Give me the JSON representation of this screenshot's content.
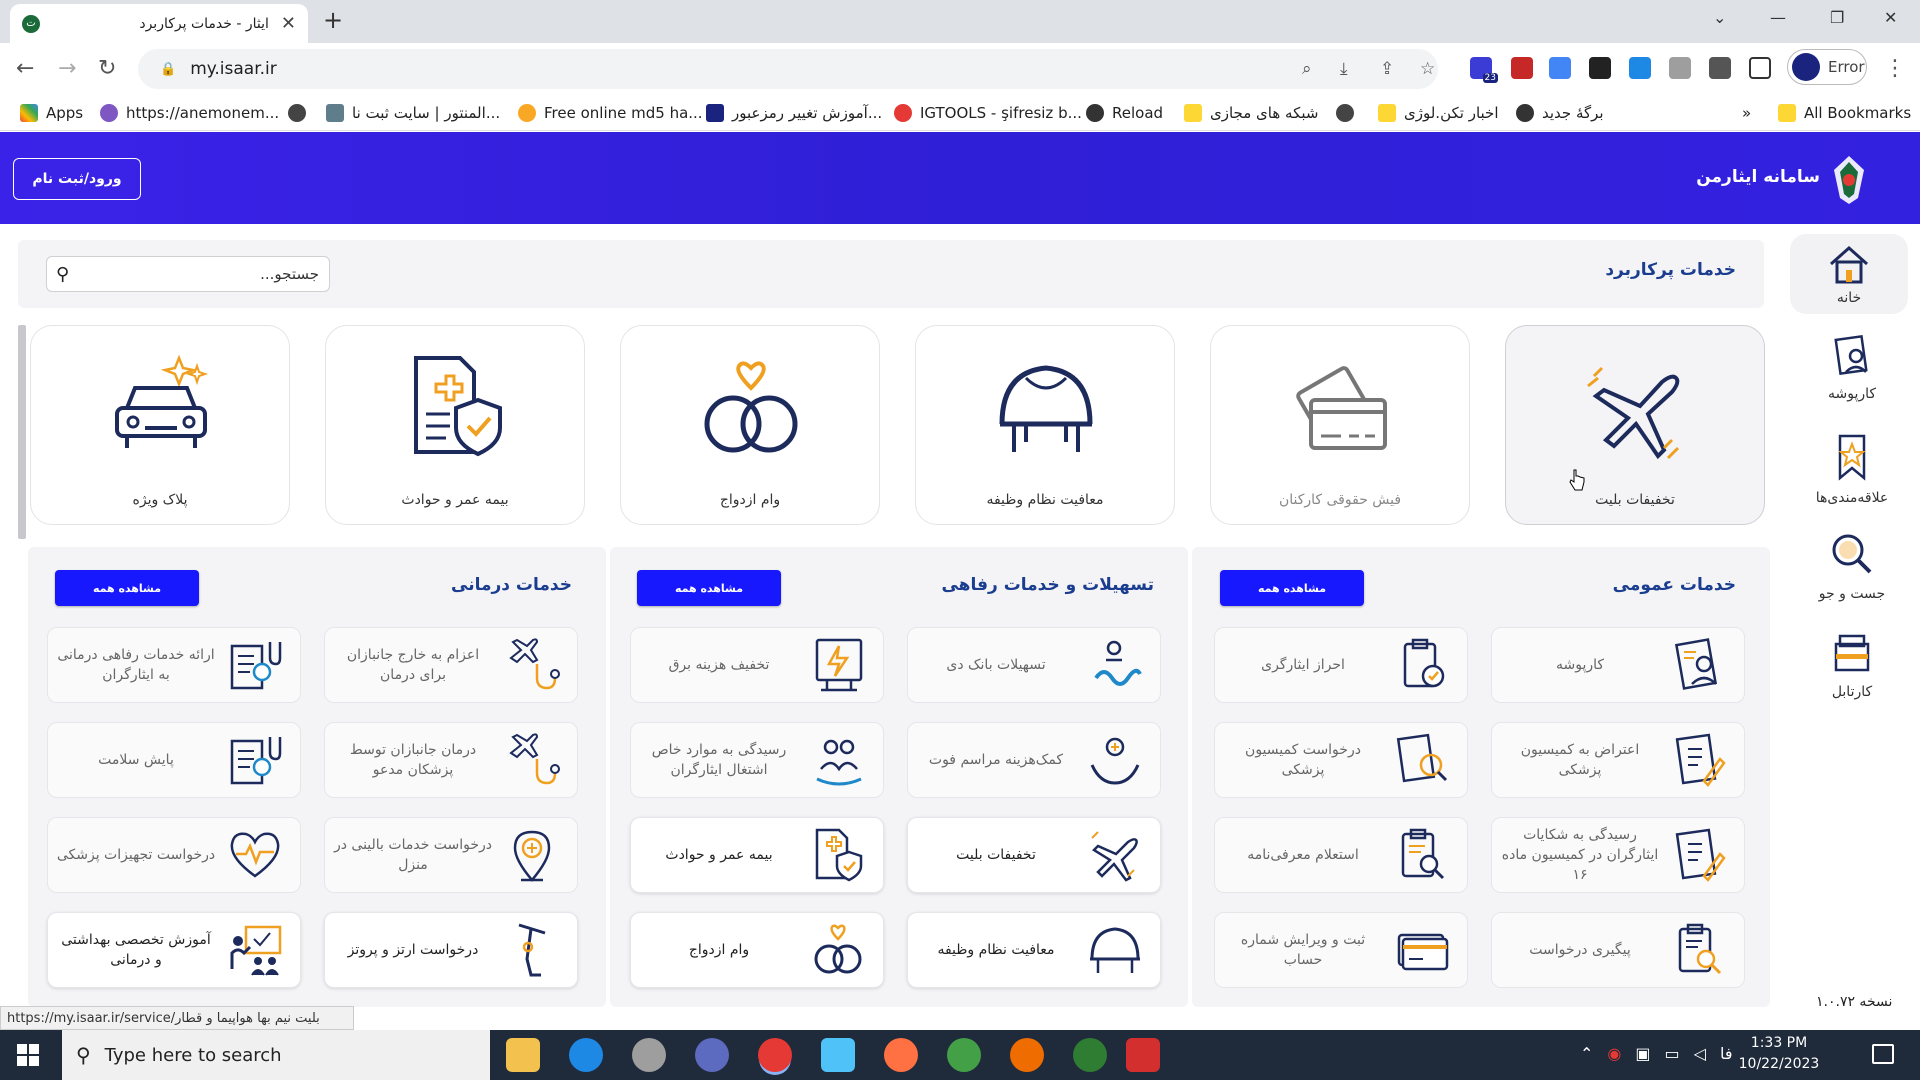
{
  "browser": {
    "tab_title": "ایثار - خدمات پرکاربرد",
    "url": "my.isaar.ir",
    "profile_label": "Error",
    "extension_badge": "23",
    "bookmarks": [
      {
        "label": "Apps"
      },
      {
        "label": "https://anemonem..."
      },
      {
        "label": "المنتور | سایت ثبت نا..."
      },
      {
        "label": "Free online md5 ha..."
      },
      {
        "label": "آموزش تغییر رمزعبور..."
      },
      {
        "label": "IGTOOLS - şifresiz b..."
      },
      {
        "label": "Reload"
      },
      {
        "label": "شبکه های مجازی"
      },
      {
        "label": "اخبار تکن.لوژی"
      },
      {
        "label": "برگهٔ جدید"
      },
      {
        "label": "All Bookmarks"
      }
    ]
  },
  "header": {
    "login_label": "ورود/ثبت نام",
    "brand": "سامانه ایثارمن"
  },
  "sidebar": {
    "items": [
      {
        "label": "خانه",
        "icon": "home-icon"
      },
      {
        "label": "کارپوشه",
        "icon": "folder-profile-icon"
      },
      {
        "label": "علاقه‌مندی‌ها",
        "icon": "bookmark-star-icon"
      },
      {
        "label": "جست و جو",
        "icon": "search-icon"
      },
      {
        "label": "کارتابل",
        "icon": "inbox-tray-icon"
      }
    ],
    "version": "نسخه ۱.۰.۷۲"
  },
  "main": {
    "search_placeholder": "جستجو...",
    "section_title": "خدمات پرکاربرد",
    "featured": [
      {
        "label": "تخفیفات بلیت",
        "icon": "airplane-icon"
      },
      {
        "label": "فیش حقوقی کارکنان",
        "icon": "payslip-cards-icon"
      },
      {
        "label": "معافیت نظام وظیفه",
        "icon": "helmet-icon"
      },
      {
        "label": "وام ازدواج",
        "icon": "rings-icon"
      },
      {
        "label": "بیمه عمر و حوادث",
        "icon": "insurance-doc-icon"
      },
      {
        "label": "پلاک ویژه",
        "icon": "car-icon"
      }
    ],
    "see_all_label": "مشاهده همه",
    "categories": [
      {
        "title": "خدمات عمومی",
        "services": [
          {
            "label": "کارپوشه",
            "icon": "folder-profile-icon"
          },
          {
            "label": "احراز ایثارگری",
            "icon": "clipboard-check-icon"
          },
          {
            "label": "اعتراض به کمیسیون پزشکی",
            "icon": "document-pen-icon"
          },
          {
            "label": "درخواست کمیسیون پزشکی",
            "icon": "document-search-icon"
          },
          {
            "label": "رسیدگی به شکایات ایثارگران در کمیسیون ماده ۱۶",
            "icon": "document-pen-icon"
          },
          {
            "label": "استعلام معرفی‌نامه",
            "icon": "clipboard-search-icon"
          },
          {
            "label": "پیگیری درخواست",
            "icon": "clipboard-search-icon"
          },
          {
            "label": "ثبت و ویرایش شماره حساب",
            "icon": "bank-card-icon"
          }
        ]
      },
      {
        "title": "تسهیلات و خدمات رفاهی",
        "services": [
          {
            "label": "تسهیلات بانک دی",
            "icon": "bank-loan-icon"
          },
          {
            "label": "تخفیف هزینه برق",
            "icon": "electric-meter-icon"
          },
          {
            "label": "کمک‌هزینه مراسم فوت",
            "icon": "hands-support-icon"
          },
          {
            "label": "رسیدگی به موارد خاص اشتغال ایثارگران",
            "icon": "people-hands-icon"
          },
          {
            "label": "تخفیفات بلیت",
            "icon": "airplane-icon"
          },
          {
            "label": "بیمه عمر و حوادث",
            "icon": "insurance-doc-icon"
          },
          {
            "label": "معافیت نظام وظیفه",
            "icon": "helmet-icon"
          },
          {
            "label": "وام ازدواج",
            "icon": "rings-icon"
          }
        ]
      },
      {
        "title": "خدمات درمانی",
        "services": [
          {
            "label": "اعزام به خارج جانبازان برای درمان",
            "icon": "plane-stethoscope-icon"
          },
          {
            "label": "ارائه خدمات رفاهی درمانی به ایثارگران",
            "icon": "medical-report-icon"
          },
          {
            "label": "درمان جانبازان توسط پزشکان مدعو",
            "icon": "plane-stethoscope-icon"
          },
          {
            "label": "پایش سلامت",
            "icon": "medical-report-icon"
          },
          {
            "label": "درخواست خدمات بالینی در منزل",
            "icon": "location-medical-icon"
          },
          {
            "label": "درخواست تجهیزات پزشکی",
            "icon": "heart-pulse-icon"
          },
          {
            "label": "درخواست ارتز و پروتز",
            "icon": "prosthesis-icon"
          },
          {
            "label": "آموزش تخصصی بهداشتی و درمانی",
            "icon": "training-board-icon"
          }
        ]
      }
    ]
  },
  "status_url": "https://my.isaar.ir/service/بلیت نیم بها هواپیما و قطار",
  "taskbar": {
    "search_placeholder": "Type here to search",
    "time": "1:33 PM",
    "date": "10/22/2023",
    "lang": "فا"
  },
  "colors": {
    "header_blue": "#3321e0",
    "button_blue": "#1818ff",
    "title_blue": "#1a3d8f",
    "icon_navy": "#1c2a5c",
    "icon_orange": "#f0a020"
  }
}
